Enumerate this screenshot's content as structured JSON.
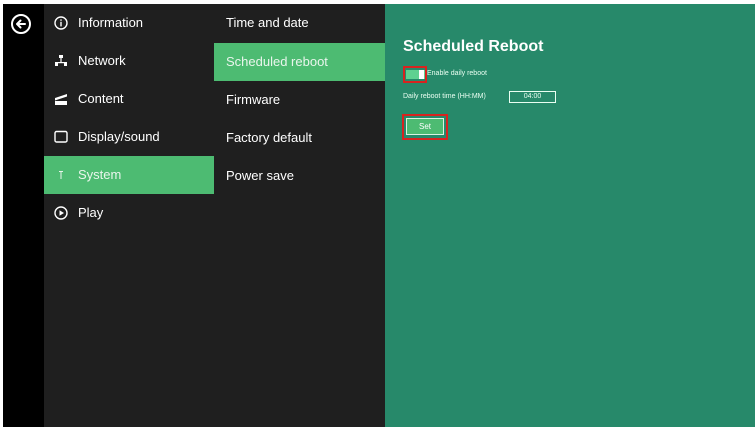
{
  "nav_primary": {
    "items": [
      {
        "label": "Information",
        "icon": "info-icon"
      },
      {
        "label": "Network",
        "icon": "network-icon"
      },
      {
        "label": "Content",
        "icon": "content-icon"
      },
      {
        "label": "Display/sound",
        "icon": "display-icon"
      },
      {
        "label": "System",
        "icon": "system-icon",
        "active": true
      },
      {
        "label": "Play",
        "icon": "play-icon"
      }
    ]
  },
  "nav_secondary": {
    "items": [
      {
        "label": "Time and date"
      },
      {
        "label": "Scheduled reboot",
        "active": true
      },
      {
        "label": "Firmware"
      },
      {
        "label": "Factory default"
      },
      {
        "label": "Power save"
      }
    ]
  },
  "panel": {
    "title": "Scheduled Reboot",
    "enable_label": "Enable daily reboot",
    "enable_on": true,
    "time_label": "Daily reboot time (HH:MM)",
    "time_value": "04:00",
    "set_label": "Set"
  },
  "colors": {
    "rail": "#000000",
    "menu_bg": "#1f1f1f",
    "active_green": "#4dbb72",
    "content_bg": "#27896a",
    "highlight_red": "#d8231f"
  }
}
